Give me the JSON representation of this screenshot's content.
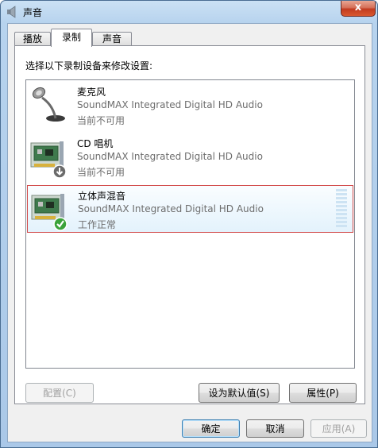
{
  "window": {
    "title": "声音",
    "close_label": "x"
  },
  "tabs": [
    {
      "label": "播放"
    },
    {
      "label": "录制"
    },
    {
      "label": "声音"
    }
  ],
  "instruction": "选择以下录制设备来修改设置:",
  "devices": [
    {
      "name": "麦克风",
      "driver": "SoundMAX Integrated Digital HD Audio",
      "status": "当前不可用",
      "icon": "microphone-icon"
    },
    {
      "name": "CD 唱机",
      "driver": "SoundMAX Integrated Digital HD Audio",
      "status": "当前不可用",
      "icon": "sound-card-icon"
    },
    {
      "name": "立体声混音",
      "driver": "SoundMAX Integrated Digital HD Audio",
      "status": "工作正常",
      "icon": "sound-card-icon"
    }
  ],
  "buttons": {
    "configure": "配置(C)",
    "set_default": "设为默认值(S)",
    "properties": "属性(P)",
    "ok": "确定",
    "cancel": "取消",
    "apply": "应用(A)"
  },
  "colors": {
    "selection_border": "#d24a4a",
    "meter_fill": "#cde3f3"
  }
}
